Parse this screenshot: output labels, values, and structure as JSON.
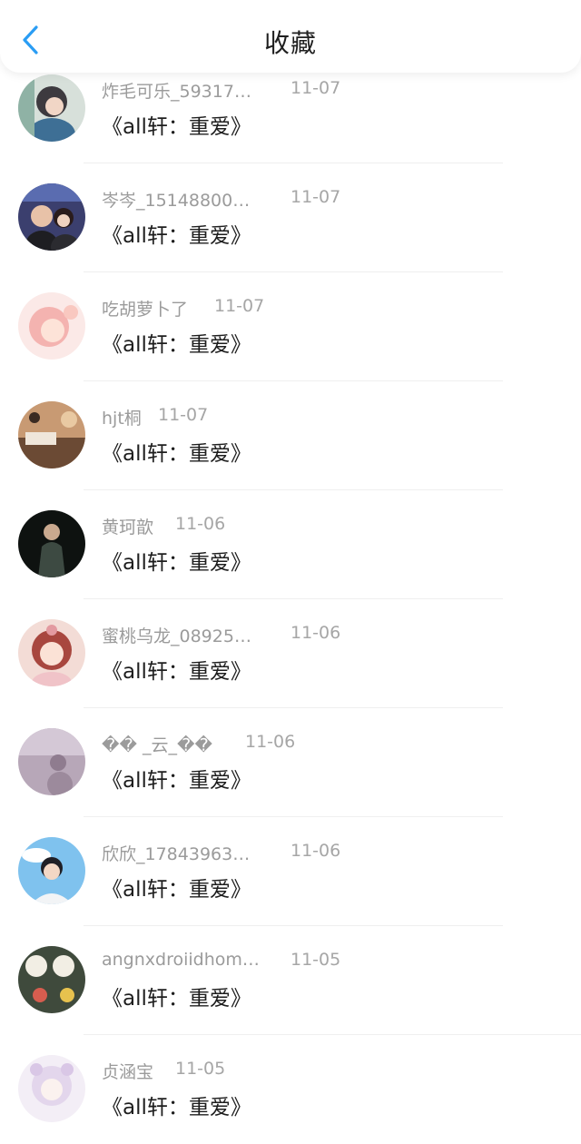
{
  "header": {
    "title": "收藏"
  },
  "items": [
    {
      "name": "炸毛可乐_59317…",
      "date": "11-07",
      "title": "《all轩：重爱》"
    },
    {
      "name": "岑岑_15148800…",
      "date": "11-07",
      "title": "《all轩：重爱》"
    },
    {
      "name": "吃胡萝卜了",
      "date": "11-07",
      "title": "《all轩：重爱》"
    },
    {
      "name": "hjt桐",
      "date": "11-07",
      "title": "《all轩：重爱》"
    },
    {
      "name": "黄珂歆",
      "date": "11-06",
      "title": "《all轩：重爱》"
    },
    {
      "name": "蜜桃乌龙_08925…",
      "date": "11-06",
      "title": "《all轩：重爱》"
    },
    {
      "name": "�� _云_��",
      "date": "11-06",
      "title": "《all轩：重爱》"
    },
    {
      "name": "欣欣_17843963…",
      "date": "11-06",
      "title": "《all轩：重爱》"
    },
    {
      "name": "angnxdroiidhom…",
      "date": "11-05",
      "title": "《all轩：重爱》"
    },
    {
      "name": "贞涵宝",
      "date": "11-05",
      "title": "《all轩：重爱》"
    }
  ],
  "colors": {
    "accent": "#2a9df4",
    "text": "#1e1e1e",
    "muted": "#9b9b9b"
  },
  "icons": {
    "back": "chevron-left-icon"
  }
}
